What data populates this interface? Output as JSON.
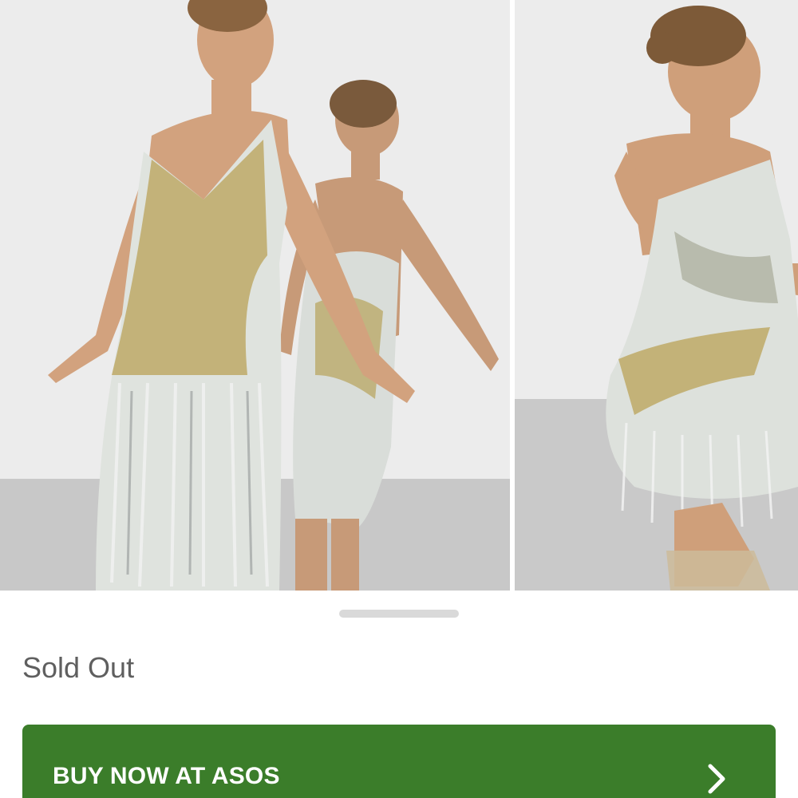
{
  "gallery": {
    "images": [
      {
        "icon": "product-photo-front-and-mirror"
      },
      {
        "icon": "product-photo-side-crouch"
      }
    ]
  },
  "product": {
    "status": "Sold Out"
  },
  "cta": {
    "label": "BUY NOW AT ASOS",
    "icon": "chevron-right-icon",
    "color": "#3b7d2a"
  }
}
